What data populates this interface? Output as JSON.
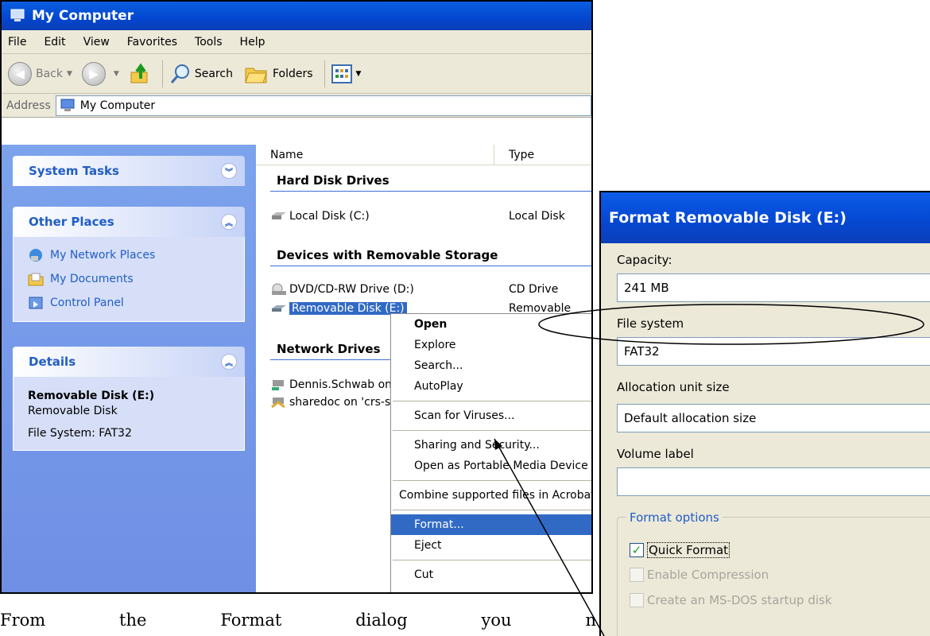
{
  "explorer": {
    "title": "My Computer",
    "menu": [
      "File",
      "Edit",
      "View",
      "Favorites",
      "Tools",
      "Help"
    ],
    "toolbar": {
      "back": "Back",
      "search": "Search",
      "folders": "Folders"
    },
    "address": {
      "label": "Address",
      "value": "My Computer"
    },
    "sidebar": {
      "system_tasks": {
        "title": "System Tasks"
      },
      "other_places": {
        "title": "Other Places",
        "items": [
          "My Network Places",
          "My Documents",
          "Control Panel"
        ]
      },
      "details": {
        "title": "Details",
        "name": "Removable Disk (E:)",
        "type": "Removable Disk",
        "fs": "File System: FAT32"
      }
    },
    "columns": {
      "name": "Name",
      "type": "Type"
    },
    "groups": {
      "hard_disk": "Hard Disk Drives",
      "removable": "Devices with Removable Storage",
      "network": "Network Drives"
    },
    "files": {
      "local": {
        "name": "Local Disk (C:)",
        "type": "Local Disk"
      },
      "dvd": {
        "name": "DVD/CD-RW Drive (D:)",
        "type": "CD Drive"
      },
      "removable": {
        "name": "Removable Disk (E:)",
        "type": "Removable Disk"
      },
      "net1": {
        "name": "Dennis.Schwab on"
      },
      "net2": {
        "name": "sharedoc on 'crs-s"
      }
    },
    "context_menu": {
      "open": "Open",
      "explore": "Explore",
      "search": "Search...",
      "autoplay": "AutoPlay",
      "scan": "Scan for Viruses...",
      "sharing": "Sharing and Security...",
      "portable": "Open as Portable Media Device",
      "combine": "Combine supported files in Acrobat",
      "format": "Format...",
      "eject": "Eject",
      "cut": "Cut"
    }
  },
  "format_dialog": {
    "title": "Format Removable Disk (E:)",
    "capacity_label": "Capacity:",
    "capacity_value": "241 MB",
    "fs_label": "File system",
    "fs_value": "FAT32",
    "alloc_label": "Allocation unit size",
    "alloc_value": "Default allocation size",
    "volume_label": "Volume label",
    "volume_value": "",
    "options_label": "Format options",
    "quick_format": {
      "label": "Quick Format",
      "checked": true
    },
    "compression": {
      "label": "Enable Compression",
      "checked": false,
      "enabled": false
    },
    "msdos": {
      "label": "Create an MS-DOS startup disk",
      "checked": false,
      "enabled": false
    }
  },
  "caption": {
    "words": [
      "From",
      "the",
      "Format",
      "dialog",
      "you",
      "n"
    ]
  },
  "colors": {
    "xp_blue": "#0346cf",
    "selection": "#316ac5",
    "sidebar": "#7ca3ec",
    "dialog_bg": "#ece9d8"
  }
}
